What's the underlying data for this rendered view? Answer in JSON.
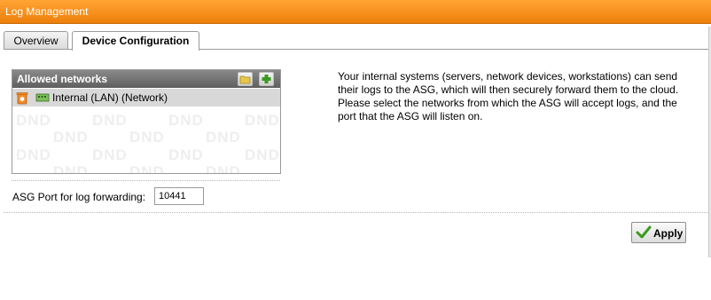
{
  "window": {
    "title": "Log Management"
  },
  "tabs": [
    {
      "label": "Overview",
      "active": false
    },
    {
      "label": "Device Configuration",
      "active": true
    }
  ],
  "allowed_networks": {
    "header": "Allowed networks",
    "buttons": {
      "folder_icon": "folder-icon",
      "add_icon": "plus-icon"
    },
    "items": [
      {
        "label": "Internal (LAN) (Network)",
        "icon": "network-icon"
      }
    ],
    "watermark": "DND"
  },
  "port": {
    "label": "ASG Port for log forwarding:",
    "value": "10441"
  },
  "description": "Your internal systems (servers, network devices, workstations) can send their logs to the ASG, which will then securely forward them to the cloud. Please select the networks from which the ASG will accept logs, and the port that the ASG will listen on.",
  "apply_label": "Apply",
  "colors": {
    "title_bar": "#f7901e",
    "box_header": "#6f6f6f",
    "selected_row": "#d8d8d8",
    "check": "#3a9a1e"
  }
}
